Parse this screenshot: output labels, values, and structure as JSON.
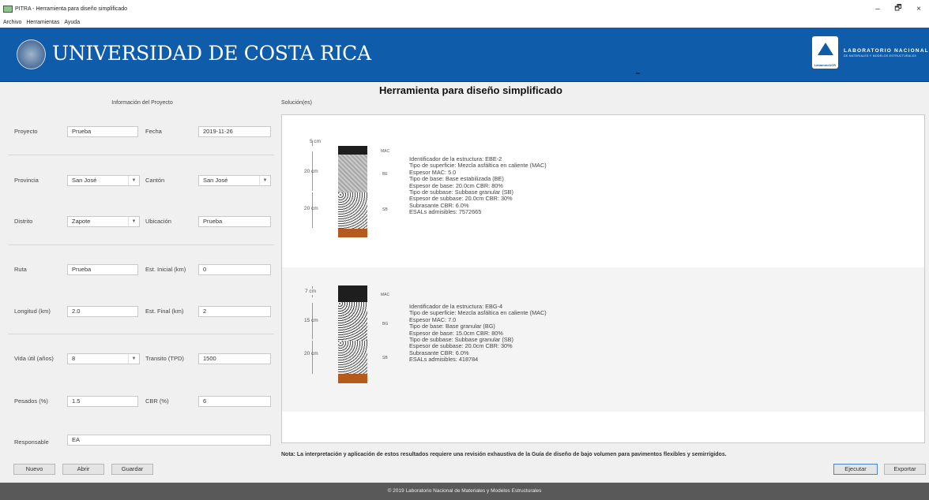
{
  "window": {
    "title": "PITRA - Herramienta para diseño simplificado",
    "controls": [
      "–",
      "🗗",
      "×"
    ]
  },
  "menu": {
    "items": [
      "Archivo",
      "Herramientas",
      "Ayuda"
    ]
  },
  "header": {
    "university": "UNIVERSIDAD DE COSTA RICA",
    "lab_line1": "LABORATORIO NACIONAL",
    "lab_line2": "DE MATERIALES Y MODELOS ESTRUCTURALES",
    "lab_logo_caption": "LanammeUCR",
    "brand_color": "#0f5cab"
  },
  "main_title": "Herramienta para diseño simplificado",
  "project": {
    "heading": "Información del Proyecto",
    "proyecto_label": "Proyecto",
    "proyecto_value": "Prueba",
    "fecha_label": "Fecha",
    "fecha_value": "2019-11-26",
    "provincia_label": "Provincia",
    "provincia_value": "San José",
    "canton_label": "Cantón",
    "canton_value": "San José",
    "distrito_label": "Distrito",
    "distrito_value": "Zapote",
    "ubicacion_label": "Ubicación",
    "ubicacion_value": "Prueba",
    "ruta_label": "Ruta",
    "ruta_value": "Prueba",
    "est_inicial_label": "Est. Inicial (km)",
    "est_inicial_value": "0",
    "longitud_label": "Longitud (km)",
    "longitud_value": "2.0",
    "est_final_label": "Est. Final (km)",
    "est_final_value": "2",
    "vida_label": "Vida útil (años)",
    "vida_value": "8",
    "transito_label": "Transito (TPD)",
    "transito_value": "1500",
    "pesados_label": "Pesados (%)",
    "pesados_value": "1.5",
    "cbr_label": "CBR (%)",
    "cbr_value": "6",
    "responsable_label": "Responsable",
    "responsable_value": "EA"
  },
  "buttons": {
    "nuevo": "Nuevo",
    "abrir": "Abrir",
    "guardar": "Guardar",
    "ejecutar": "Ejecutar",
    "exportar": "Exportar"
  },
  "solutions": {
    "heading": "Solución(es)",
    "items": [
      {
        "dims": [
          "5 cm",
          "20 cm",
          "20 cm"
        ],
        "codes": [
          "MAC",
          "BE",
          "SB"
        ],
        "lines": [
          "Identificador de la estructura:  EBE-2",
          "Tipo de superficie:  Mezcla asfáltica en caliente (MAC)",
          "Espesor MAC:       5.0",
          "Tipo de base:  Base estabilizada (BE)",
          "Espesor de base:   20.0cm   CBR: 80%",
          "Tipo de subbase:    Subbase granular (SB)",
          "Espesor de subbase:     20.0cm   CBR: 30%",
          "Subrasante CBR: 6.0%",
          "ESALs admisibles: 7572665"
        ]
      },
      {
        "dims": [
          "7 cm",
          "15 cm",
          "20 cm"
        ],
        "codes": [
          "MAC",
          "BG",
          "SB"
        ],
        "lines": [
          "Identificador de la estructura:  EBG-4",
          "Tipo de superficie:  Mezcla asfáltica en caliente (MAC)",
          "Espesor MAC:       7.0",
          "Tipo de base:  Base granular (BG)",
          "Espesor de base:    15.0cm   CBR: 80%",
          "Tipo de subbase:   Subbase granular (SB)",
          "Espesor de subbase:     20.0cm   CBR: 30%",
          "Subrasante CBR: 6.0%",
          "ESALs admisibles: 418784"
        ]
      }
    ]
  },
  "note": "Nota: La interpretación y aplicación de estos resultados requiere una revisión exhaustiva de la Guía de diseño de bajo volumen para pavimentos flexibles y semirrígidos.",
  "footer": "© 2019 Laboratorio Nacional de Materiales y Modelos Estructurales"
}
